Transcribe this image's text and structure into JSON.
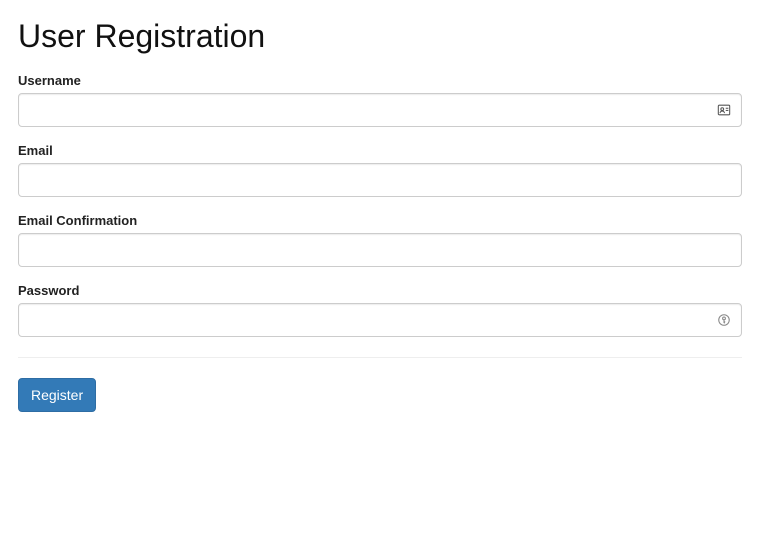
{
  "page": {
    "title": "User Registration"
  },
  "form": {
    "username": {
      "label": "Username",
      "value": ""
    },
    "email": {
      "label": "Email",
      "value": ""
    },
    "email_confirmation": {
      "label": "Email Confirmation",
      "value": ""
    },
    "password": {
      "label": "Password",
      "value": ""
    },
    "submit_label": "Register"
  },
  "icons": {
    "username_autofill": "contact-card-icon",
    "password_suggest": "key-icon"
  }
}
